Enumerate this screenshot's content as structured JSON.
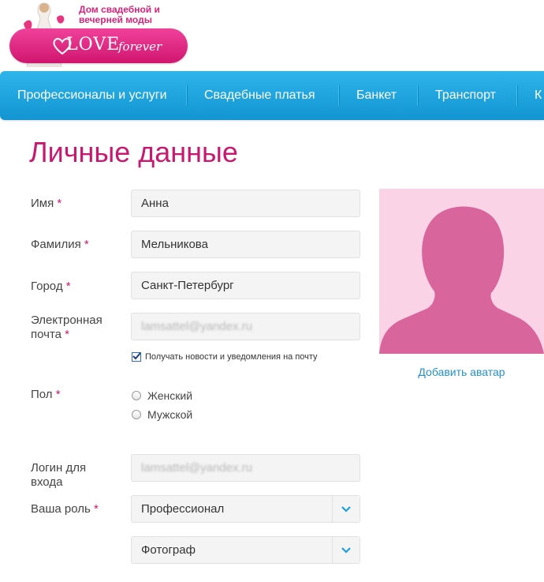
{
  "brand": {
    "tagline": "Дом свадебной и вечерней моды",
    "wordmark_main": "LOVE",
    "wordmark_sub": "forever",
    "color": "#d6247b"
  },
  "nav": {
    "items": [
      {
        "label": "Профессионалы и услуги"
      },
      {
        "label": "Свадебные платья"
      },
      {
        "label": "Банкет"
      },
      {
        "label": "Транспорт"
      },
      {
        "label": "К"
      }
    ],
    "color": "#1a9fdc"
  },
  "page": {
    "title": "Личные данные",
    "accent_color": "#c7196f"
  },
  "form": {
    "required_mark": "*",
    "first_name": {
      "label": "Имя",
      "value": "Анна"
    },
    "last_name": {
      "label": "Фамилия",
      "value": "Мельникова"
    },
    "city": {
      "label": "Город",
      "value": "Санкт-Петербург"
    },
    "email": {
      "label_line1": "Электронная",
      "label_line2": "почта",
      "value": "lamsattel@yandex.ru"
    },
    "newsletter": {
      "label": "Получать новости и уведомления на почту",
      "checked": true
    },
    "gender": {
      "label": "Пол",
      "options": [
        {
          "label": "Женский",
          "selected": false
        },
        {
          "label": "Мужской",
          "selected": false
        }
      ]
    },
    "login": {
      "label_line1": "Логин для",
      "label_line2": "входа",
      "value": "lamsattel@yandex.ru"
    },
    "role": {
      "label": "Ваша роль",
      "value": "Профессионал"
    },
    "specialty": {
      "value": "Фотограф"
    }
  },
  "avatar": {
    "add_label": "Добавить аватар",
    "placeholder_bg": "#fbd3e6",
    "silhouette_color": "#d9659d"
  }
}
